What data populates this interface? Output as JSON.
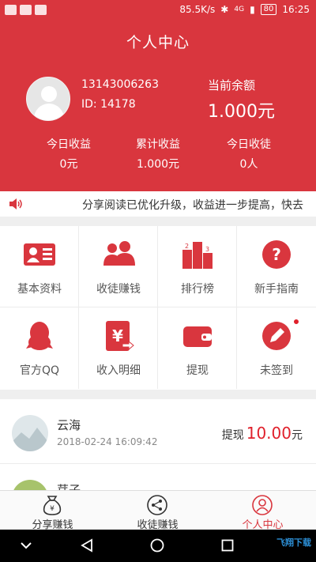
{
  "status_bar": {
    "speed": "85.5K/s",
    "network": "4G",
    "battery": "80",
    "time": "16:25"
  },
  "header": {
    "title": "个人中心",
    "phone": "13143006263",
    "user_id": "ID: 14178",
    "balance_label": "当前余额",
    "balance_value": "1.000元",
    "stats": [
      {
        "label": "今日收益",
        "value": "0元"
      },
      {
        "label": "累计收益",
        "value": "1.000元"
      },
      {
        "label": "今日收徒",
        "value": "0人"
      }
    ]
  },
  "notice": {
    "icon": "speaker-icon",
    "text": "分享阅读已优化升级，收益进一步提高，快去"
  },
  "menu": [
    {
      "label": "基本资料",
      "icon": "profile-card-icon"
    },
    {
      "label": "收徒赚钱",
      "icon": "people-icon"
    },
    {
      "label": "排行榜",
      "icon": "podium-icon"
    },
    {
      "label": "新手指南",
      "icon": "question-icon"
    },
    {
      "label": "官方QQ",
      "icon": "qq-penguin-icon"
    },
    {
      "label": "收入明细",
      "icon": "yuan-document-icon"
    },
    {
      "label": "提现",
      "icon": "wallet-icon"
    },
    {
      "label": "未签到",
      "icon": "pencil-icon"
    }
  ],
  "records": [
    {
      "name": "云海",
      "time": "2018-02-24 16:09:42",
      "action": "提现",
      "amount": "10.00",
      "unit": "元"
    },
    {
      "name": "芽子"
    }
  ],
  "tabbar": [
    {
      "label": "分享赚钱",
      "icon": "money-bag-icon"
    },
    {
      "label": "收徒赚钱",
      "icon": "share-icon"
    },
    {
      "label": "个人中心",
      "icon": "user-circle-icon",
      "active": true
    }
  ],
  "colors": {
    "brand_red": "#d9363e",
    "amount_red": "#e0202b"
  },
  "watermark": "飞翔下载"
}
